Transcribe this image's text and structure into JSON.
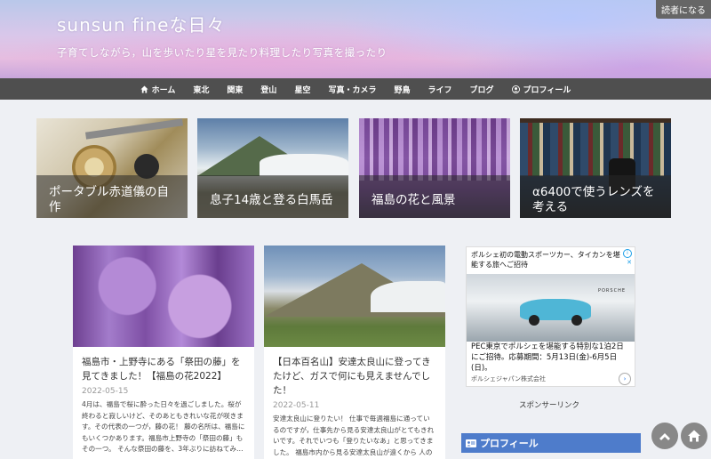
{
  "header": {
    "title": "sunsun fineな日々",
    "description": "子育てしながら，山を歩いたり星を見たり料理したり写真を撮ったり",
    "reader_button": "読者になる"
  },
  "nav": {
    "items": [
      {
        "label": "ホーム",
        "icon": "home-icon"
      },
      {
        "label": "東北"
      },
      {
        "label": "関東"
      },
      {
        "label": "登山"
      },
      {
        "label": "星空"
      },
      {
        "label": "写真・カメラ"
      },
      {
        "label": "野鳥"
      },
      {
        "label": "ライフ"
      },
      {
        "label": "ブログ"
      },
      {
        "label": "プロフィール",
        "icon": "user-icon"
      }
    ]
  },
  "features": [
    {
      "caption": "ポータブル赤道儀の自作"
    },
    {
      "caption": "息子14歳と登る白馬岳"
    },
    {
      "caption": "福島の花と風景"
    },
    {
      "caption": "α6400で使うレンズを考える"
    }
  ],
  "posts": [
    {
      "title": "福島市・上野寺にある「祭田の藤」を見てきました！【福島の花2022】",
      "date": "2022-05-15",
      "excerpt": "4月は、福島で桜に酔った日々を過ごしました。桜が終わると寂しいけど、そのあともきれいな花が咲きます。その代表の一つが，藤の花！ 藤の名所は、福島にもいくつかあります。福島市上野寺の「祭田の藤」もその一つ。 そんな祭田の藤を、3年ぶりに訪ねてみ…"
    },
    {
      "title": "【日本百名山】安達太良山に登ってきたけど、ガスで何にも見えませんでした！",
      "date": "2022-05-11",
      "excerpt": "安達太良山に登りたい！ 仕事で毎週福島に通っているのですが，仕事先から見る安達太良山がとてもきれいです。それでいつも「登りたいなあ」と思ってきました。 福島市内から見る安達太良山が遠くから 人の心をとりこにする 人がその心を 探しにゆく それ…"
    }
  ],
  "ad": {
    "headline": "ポルシェ初の電動スポーツカー、タイカンを堪能する旅へご招待",
    "brand": "PORSCHE",
    "body": "PEC東京でポルシェを堪能する特別な1泊2日にご招待。応募期間：5月13日(金)-6月5日(日)。",
    "advertiser": "ポルシェジャパン株式会社",
    "info_icon": "i",
    "close_icon": "✕"
  },
  "sidebar": {
    "sponsor_label": "スポンサーリンク",
    "profile_heading": "プロフィール"
  }
}
